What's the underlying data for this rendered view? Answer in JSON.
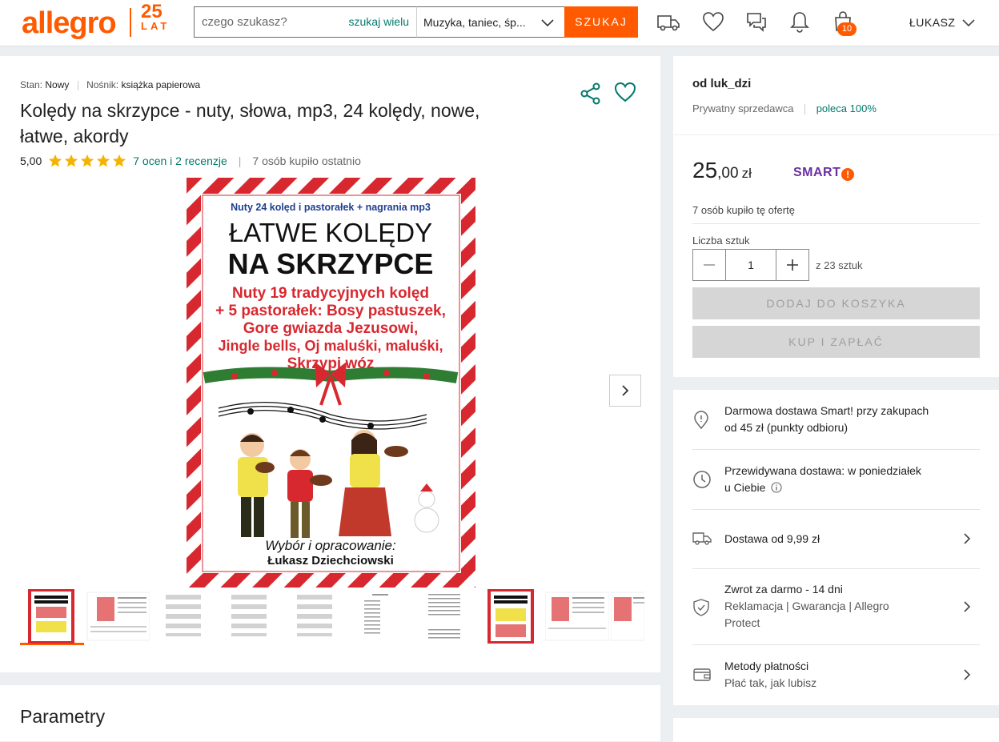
{
  "header": {
    "logo": "allegro",
    "anniversary_number": "25",
    "anniversary_text": "LAT",
    "search_placeholder": "czego szukasz?",
    "search_many_label": "szukaj wielu",
    "category_value": "Muzyka, taniec, śp...",
    "search_button": "SZUKAJ",
    "cart_count": "10",
    "user_name": "ŁUKASZ"
  },
  "product": {
    "state_label": "Stan:",
    "state_value": "Nowy",
    "medium_label": "Nośnik:",
    "medium_value": "książka papierowa",
    "title": "Kolędy na skrzypce - nuty, słowa, mp3, 24 kolędy, nowe, łatwe, akordy",
    "rating": "5,00",
    "rating_link": "7 ocen i 2 recenzje",
    "bought_recently": "7 osób kupiło ostatnio"
  },
  "cover": {
    "top_line": "Nuty 24 kolęd i pastorałek + nagrania mp3",
    "title_1": "ŁATWE KOLĘDY",
    "title_2": "NA SKRZYPCE",
    "desc_1": "Nuty 19 tradycyjnych kolęd",
    "desc_2": "+ 5 pastorałek: Bosy pastuszek,",
    "desc_3": "Gore gwiazda Jezusowi,",
    "desc_4": "Jingle bells, Oj maluśki, maluśki,",
    "desc_5": "Skrzypi wóz",
    "author_label": "Wybór i opracowanie:",
    "author_name": "Łukasz Dziechciowski"
  },
  "sections": {
    "parameters_title": "Parametry"
  },
  "seller": {
    "name": "od luk_dzi",
    "type": "Prywatny sprzedawca",
    "recommendation": "poleca 100%"
  },
  "buy": {
    "price_main": "25",
    "price_cents": ",00",
    "currency": "zł",
    "smart_label": "SMART",
    "smart_badge": "!",
    "bought_count": "7 osób kupiło tę ofertę",
    "qty_label": "Liczba sztuk",
    "qty_value": "1",
    "qty_of": "z 23 sztuk",
    "add_to_cart": "DODAJ DO KOSZYKA",
    "buy_now": "KUP I ZAPŁAĆ"
  },
  "info": {
    "smart_delivery_1": "Darmowa dostawa Smart! przy zakupach",
    "smart_delivery_2": "od 45 zł (punkty odbioru)",
    "expected_1": "Przewidywana dostawa: w poniedziałek",
    "expected_2": "u Ciebie",
    "delivery_from": "Dostawa od 9,99 zł",
    "return_1": "Zwrot za darmo - 14 dni",
    "return_2": "Reklamacja | Gwarancja | Allegro",
    "return_3": "Protect",
    "payment_1": "Metody płatności",
    "payment_2": "Płać tak, jak lubisz"
  },
  "colors": {
    "brand": "#ff5a00",
    "link": "#00796b",
    "smart": "#6a2fa3",
    "star": "#f5b301"
  }
}
